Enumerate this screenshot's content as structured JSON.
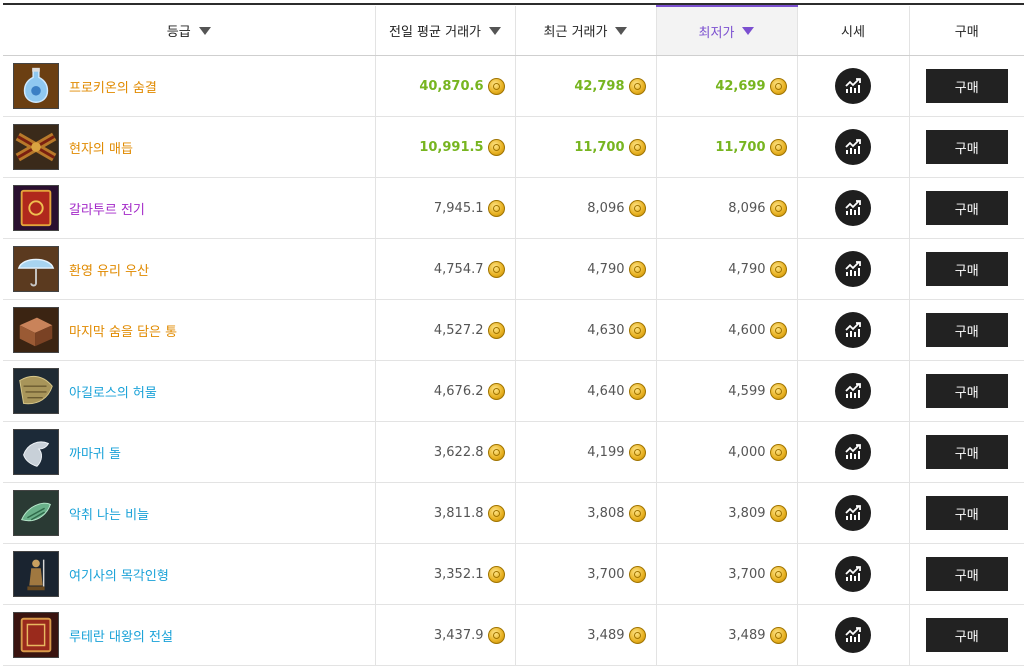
{
  "header": {
    "grade": "등급",
    "prev_avg": "전일 평균 거래가",
    "recent": "최근 거래가",
    "lowest": "최저가",
    "market_price": "시세",
    "buy": "구매"
  },
  "colors": {
    "sorted_accent": "#7b4fd0",
    "price_green": "#77b520"
  },
  "items": [
    {
      "name": "프로키온의 숨결",
      "grade": "legendary",
      "prev_avg": "40,870.6",
      "recent": "42,798",
      "lowest": "42,699",
      "highlight": true,
      "buy": "구매",
      "icon": "blue-potion-bottle-icon"
    },
    {
      "name": "현자의 매듭",
      "grade": "legendary",
      "prev_avg": "10,991.5",
      "recent": "11,700",
      "lowest": "11,700",
      "highlight": true,
      "buy": "구매",
      "icon": "knotted-cloth-icon"
    },
    {
      "name": "갈라투르 전기",
      "grade": "epic",
      "prev_avg": "7,945.1",
      "recent": "8,096",
      "lowest": "8,096",
      "highlight": false,
      "buy": "구매",
      "icon": "red-book-icon"
    },
    {
      "name": "환영 유리 우산",
      "grade": "legendary",
      "prev_avg": "4,754.7",
      "recent": "4,790",
      "lowest": "4,790",
      "highlight": false,
      "buy": "구매",
      "icon": "glass-umbrella-icon"
    },
    {
      "name": "마지막 숨을 담은 통",
      "grade": "legendary",
      "prev_avg": "4,527.2",
      "recent": "4,630",
      "lowest": "4,600",
      "highlight": false,
      "buy": "구매",
      "icon": "wooden-box-icon"
    },
    {
      "name": "아길로스의 허물",
      "grade": "rare",
      "prev_avg": "4,676.2",
      "recent": "4,640",
      "lowest": "4,599",
      "highlight": false,
      "buy": "구매",
      "icon": "shed-skin-icon"
    },
    {
      "name": "까마귀 돌",
      "grade": "rare",
      "prev_avg": "3,622.8",
      "recent": "4,199",
      "lowest": "4,000",
      "highlight": false,
      "buy": "구매",
      "icon": "raven-stone-icon"
    },
    {
      "name": "악취 나는 비늘",
      "grade": "rare",
      "prev_avg": "3,811.8",
      "recent": "3,808",
      "lowest": "3,809",
      "highlight": false,
      "buy": "구매",
      "icon": "green-scales-icon"
    },
    {
      "name": "여기사의 목각인형",
      "grade": "rare",
      "prev_avg": "3,352.1",
      "recent": "3,700",
      "lowest": "3,700",
      "highlight": false,
      "buy": "구매",
      "icon": "knight-figurine-icon"
    },
    {
      "name": "루테란 대왕의 전설",
      "grade": "rare",
      "prev_avg": "3,437.9",
      "recent": "3,489",
      "lowest": "3,489",
      "highlight": false,
      "buy": "구매",
      "icon": "legend-book-icon"
    }
  ]
}
